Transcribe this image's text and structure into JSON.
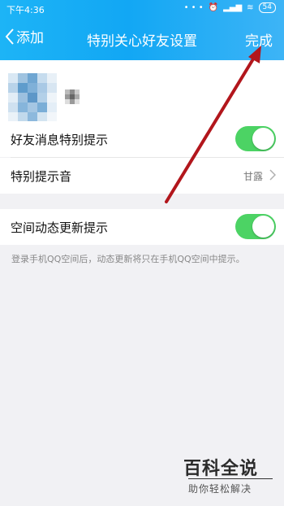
{
  "status_bar": {
    "time": "下午4:36",
    "battery": "54"
  },
  "nav": {
    "back_label": "添加",
    "title": "特别关心好友设置",
    "done_label": "完成"
  },
  "settings": [
    {
      "label": "好友消息特别提示",
      "toggle_on": true
    },
    {
      "label": "特别提示音",
      "value": "甘露"
    },
    {
      "label": "空间动态更新提示",
      "toggle_on": true
    }
  ],
  "footnote": "登录手机QQ空间后，动态更新将只在手机QQ空间中提示。",
  "watermark": {
    "title": "百科全说",
    "subtitle": "助你轻松解决"
  },
  "colors": {
    "header_blue": "#12a7f4",
    "toggle_green": "#4cd364",
    "annotation_arrow": "#b2161c"
  },
  "icons": {
    "back": "chevron-left-icon",
    "next": "chevron-right-icon"
  }
}
